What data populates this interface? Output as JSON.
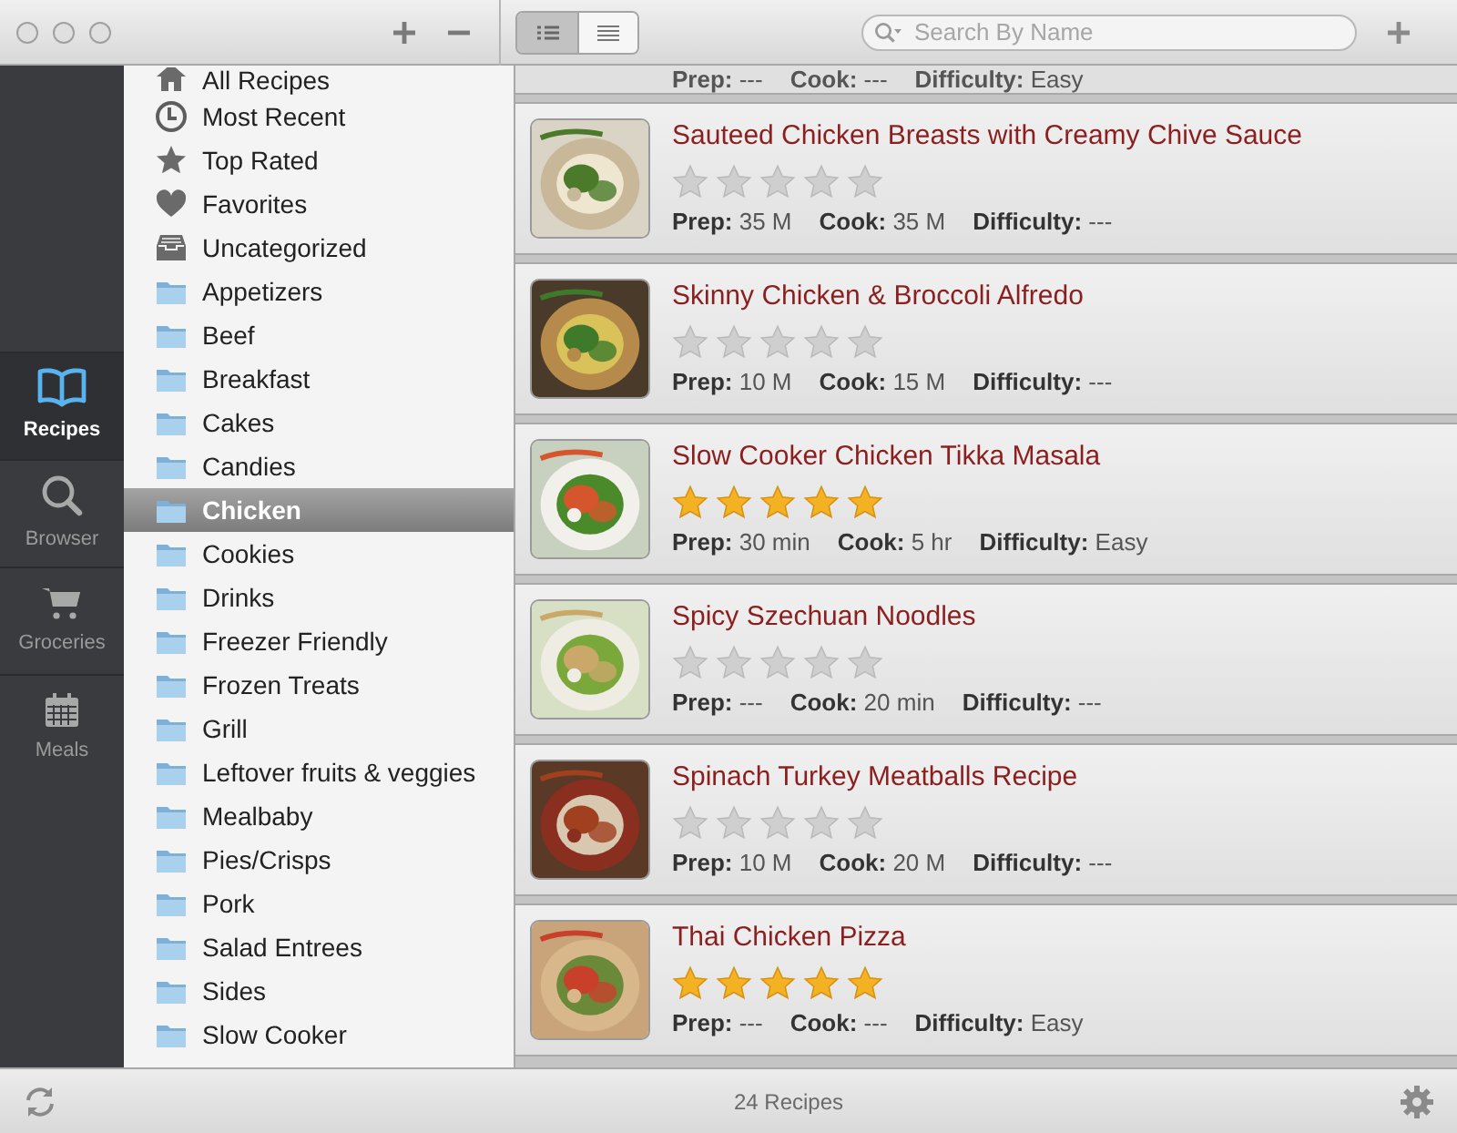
{
  "toolbar": {
    "view_modes": [
      {
        "kind": "detailed",
        "selected": true
      },
      {
        "kind": "compact",
        "selected": false
      }
    ],
    "search": {
      "placeholder": "Search By Name"
    }
  },
  "nav": [
    {
      "kind": "book",
      "label": "Recipes",
      "selected": true
    },
    {
      "kind": "search",
      "label": "Browser",
      "selected": false
    },
    {
      "kind": "cart",
      "label": "Groceries",
      "selected": false
    },
    {
      "kind": "calendar",
      "label": "Meals",
      "selected": false
    }
  ],
  "categories": [
    {
      "kind": "home",
      "label": "All Recipes",
      "selected": false
    },
    {
      "kind": "clock",
      "label": "Most Recent",
      "selected": false
    },
    {
      "kind": "star",
      "label": "Top Rated",
      "selected": false
    },
    {
      "kind": "heart",
      "label": "Favorites",
      "selected": false
    },
    {
      "kind": "tray",
      "label": "Uncategorized",
      "selected": false
    },
    {
      "kind": "folder",
      "label": "Appetizers",
      "selected": false
    },
    {
      "kind": "folder",
      "label": "Beef",
      "selected": false
    },
    {
      "kind": "folder",
      "label": "Breakfast",
      "selected": false
    },
    {
      "kind": "folder",
      "label": "Cakes",
      "selected": false
    },
    {
      "kind": "folder",
      "label": "Candies",
      "selected": false
    },
    {
      "kind": "folder",
      "label": "Chicken",
      "selected": true
    },
    {
      "kind": "folder",
      "label": "Cookies",
      "selected": false
    },
    {
      "kind": "folder",
      "label": "Drinks",
      "selected": false
    },
    {
      "kind": "folder",
      "label": "Freezer Friendly",
      "selected": false
    },
    {
      "kind": "folder",
      "label": "Frozen Treats",
      "selected": false
    },
    {
      "kind": "folder",
      "label": "Grill",
      "selected": false
    },
    {
      "kind": "folder",
      "label": "Leftover fruits & veggies",
      "selected": false
    },
    {
      "kind": "folder",
      "label": "Mealbaby",
      "selected": false
    },
    {
      "kind": "folder",
      "label": "Pies/Crisps",
      "selected": false
    },
    {
      "kind": "folder",
      "label": "Pork",
      "selected": false
    },
    {
      "kind": "folder",
      "label": "Salad Entrees",
      "selected": false
    },
    {
      "kind": "folder",
      "label": "Sides",
      "selected": false
    },
    {
      "kind": "folder",
      "label": "Slow Cooker",
      "selected": false
    }
  ],
  "recipes": [
    {
      "meta": [
        "**Prep:** ---",
        "**Cook:** ---",
        "**Difficulty:** Easy"
      ]
    },
    {
      "title": "Sauteed Chicken Breasts with Creamy Chive Sauce",
      "stars": 0,
      "meta": [
        "**Prep:** 35 M",
        "**Cook:** 35 M",
        "**Difficulty:** ---"
      ]
    },
    {
      "title": "Skinny Chicken & Broccoli Alfredo",
      "stars": 0,
      "meta": [
        "**Prep:** 10 M",
        "**Cook:** 15 M",
        "**Difficulty:** ---"
      ]
    },
    {
      "title": "Slow Cooker Chicken Tikka Masala",
      "stars": 5,
      "meta": [
        "**Prep:** 30 min",
        "**Cook:** 5 hr",
        "**Difficulty:** Easy"
      ]
    },
    {
      "title": "Spicy Szechuan Noodles",
      "stars": 0,
      "meta": [
        "**Prep:** ---",
        "**Cook:** 20 min",
        "**Difficulty:** ---"
      ]
    },
    {
      "title": "Spinach Turkey Meatballs Recipe",
      "stars": 0,
      "meta": [
        "**Prep:** 10 M",
        "**Cook:** 20 M",
        "**Difficulty:** ---"
      ]
    },
    {
      "title": "Thai Chicken Pizza",
      "stars": 5,
      "meta": [
        "**Prep:** ---",
        "**Cook:** ---",
        "**Difficulty:** Easy"
      ]
    }
  ],
  "status_bar": {
    "count": "24 Recipes"
  }
}
